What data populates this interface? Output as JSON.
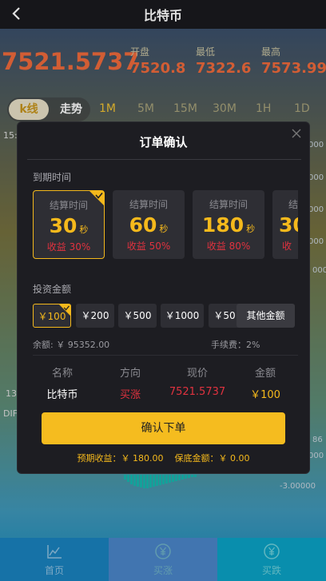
{
  "header": {
    "title": "比特币"
  },
  "ticker": {
    "price": "7521.5737",
    "open_label": "开盘",
    "open_value": "7520.8",
    "low_label": "最低",
    "low_value": "7322.6",
    "high_label": "最高",
    "high_value": "7573.99"
  },
  "chart_tabs": {
    "kline": "k线",
    "trend": "走势",
    "intervals": [
      "1M",
      "5M",
      "15M",
      "30M",
      "1H",
      "1D"
    ]
  },
  "chart_side": {
    "left_top": "15:",
    "left_mid": "13",
    "left_dif": "DIF",
    "right": [
      "000",
      "000",
      "000",
      "000",
      "37",
      "000",
      "86",
      "000",
      "-3.00000"
    ]
  },
  "modal": {
    "title": "订单确认",
    "expiry_label": "到期时间",
    "cards": [
      {
        "label": "结算时间",
        "num": "30",
        "unit": "秒",
        "rate": "收益 30%"
      },
      {
        "label": "结算时间",
        "num": "60",
        "unit": "秒",
        "rate": "收益 50%"
      },
      {
        "label": "结算时间",
        "num": "180",
        "unit": "秒",
        "rate": "收益 80%"
      },
      {
        "label": "结",
        "num": "30",
        "unit": "",
        "rate": "收"
      }
    ],
    "amount_label": "投资金额",
    "amounts": [
      "￥100",
      "￥200",
      "￥500",
      "￥1000",
      "￥50"
    ],
    "other_amount": "其他金额",
    "balance": "余额: ￥ 95352.00",
    "fee": "手续费：2%",
    "table_headers": [
      "名称",
      "方向",
      "现价",
      "金额"
    ],
    "table_values": [
      "比特币",
      "买涨",
      "7521.5737",
      "￥100"
    ],
    "confirm": "确认下单",
    "footer": "预期收益：￥ 180.00    保底金额：￥ 0.00"
  },
  "nav": {
    "home": "首页",
    "buy": "买涨",
    "sell": "买跌"
  },
  "colors": {
    "accent": "#f5bc1f",
    "up": "#e0323f",
    "price": "#ef6a3c"
  }
}
